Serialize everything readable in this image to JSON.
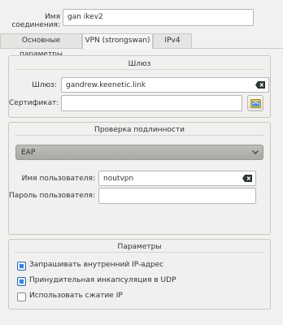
{
  "connection": {
    "name_label": "Имя соединения:",
    "name_value": "gan ikev2"
  },
  "tabs": [
    {
      "label": "Основные параметры",
      "active": false
    },
    {
      "label": "VPN (strongswan)",
      "active": true
    },
    {
      "label": "IPv4",
      "active": false
    }
  ],
  "gateway": {
    "title": "Шлюз",
    "gateway_label": "Шлюз:",
    "gateway_value": "gandrew.keenetic.link",
    "certificate_label": "Сертификат:",
    "certificate_value": "",
    "clear_icon": "edit-clear-icon",
    "browse_icon": "folder-open-icon"
  },
  "auth": {
    "title": "Проверка подлинности",
    "method_selected": "EAP",
    "username_label": "Имя пользователя:",
    "username_value": "noutvpn",
    "password_label": "Пароль пользователя:",
    "password_value": ""
  },
  "params": {
    "title": "Параметры",
    "options": [
      {
        "label": "Запрашивать внутренний IP-адрес",
        "checked": true
      },
      {
        "label": "Принудительная инкапсуляция в UDP",
        "checked": true
      },
      {
        "label": "Использовать сжатие IP",
        "checked": false
      }
    ]
  },
  "colors": {
    "accent": "#3584e4",
    "window_bg": "#f2f1f0"
  }
}
